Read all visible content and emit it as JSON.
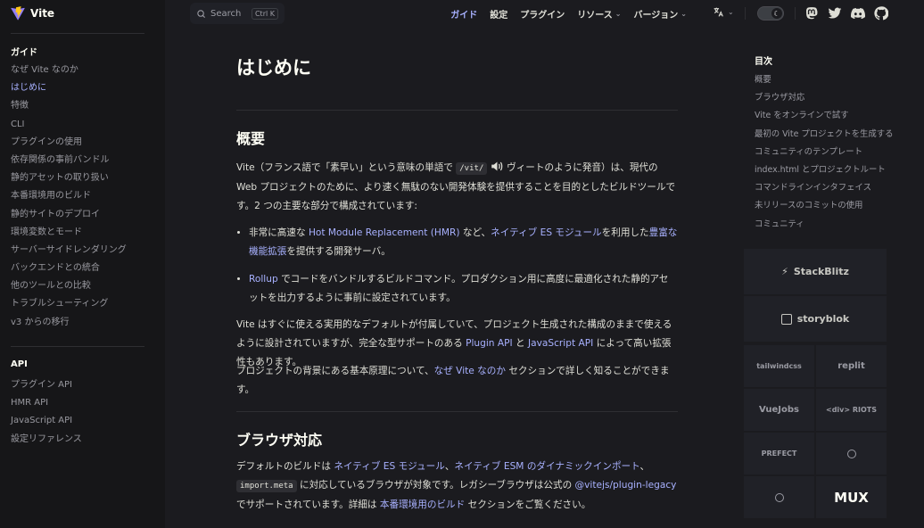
{
  "brand": {
    "title": "Vite",
    "logo_icon": "vite-logo-icon",
    "accent": "#a8b1ff"
  },
  "sidebar": {
    "guide": {
      "heading": "ガイド",
      "items": [
        {
          "label": "なぜ Vite なのか"
        },
        {
          "label": "はじめに",
          "active": true
        },
        {
          "label": "特徴"
        },
        {
          "label": "CLI"
        },
        {
          "label": "プラグインの使用"
        },
        {
          "label": "依存関係の事前バンドル"
        },
        {
          "label": "静的アセットの取り扱い"
        },
        {
          "label": "本番環境用のビルド"
        },
        {
          "label": "静的サイトのデプロイ"
        },
        {
          "label": "環境変数とモード"
        },
        {
          "label": "サーバーサイドレンダリング"
        },
        {
          "label": "バックエンドとの統合"
        },
        {
          "label": "他のツールとの比較"
        },
        {
          "label": "トラブルシューティング"
        },
        {
          "label": "v3 からの移行"
        }
      ]
    },
    "api": {
      "heading": "API",
      "items": [
        {
          "label": "プラグイン API"
        },
        {
          "label": "HMR API"
        },
        {
          "label": "JavaScript API"
        },
        {
          "label": "設定リファレンス"
        }
      ]
    }
  },
  "topbar": {
    "search": {
      "label": "Search",
      "shortcut": "Ctrl K",
      "icon": "search-icon"
    },
    "nav": [
      {
        "label": "ガイド",
        "active": true
      },
      {
        "label": "設定"
      },
      {
        "label": "プラグイン"
      },
      {
        "label": "リソース",
        "dropdown": true
      },
      {
        "label": "バージョン",
        "dropdown": true
      }
    ],
    "lang_icon": "translate-icon",
    "theme_icon": "moon-icon",
    "social": [
      "mastodon-icon",
      "twitter-icon",
      "discord-icon",
      "github-icon"
    ]
  },
  "main": {
    "title": "はじめに",
    "overview": {
      "heading": "概要",
      "p1": {
        "a": "Vite（フランス語で「素早い」という意味の単語で ",
        "code": "/vit/",
        "b": " ヴィートのように発音）は、現代の Web プロジェクトのために、より速く無駄のない開発体験を提供することを目的としたビルドツールです。2 つの主要な部分で構成されています:"
      },
      "bullet1": {
        "a": "非常に高速な ",
        "link1": "Hot Module Replacement (HMR)",
        "b": " など、",
        "link2": "ネイティブ ES モジュール",
        "c": "を利用した",
        "link3": "豊富な機能拡張",
        "d": "を提供する開発サーバ。"
      },
      "bullet2": {
        "link1": "Rollup",
        "a": " でコードをバンドルするビルドコマンド。プロダクション用に高度に最適化された静的アセットを出力するように事前に設定されています。"
      },
      "p2": {
        "a": "Vite はすぐに使える実用的なデフォルトが付属していて、プロジェクト生成された構成のままで使えるように設計されていますが、完全な型サポートのある ",
        "link1": "Plugin API",
        "b": " と ",
        "link2": "JavaScript API",
        "c": " によって高い拡張性もあります。"
      },
      "p3": {
        "a": "プロジェクトの背景にある基本原理について、",
        "link1": "なぜ Vite なのか",
        "b": " セクションで詳しく知ることができます。"
      }
    },
    "browser": {
      "heading": "ブラウザ対応",
      "p1": {
        "a": "デフォルトのビルドは ",
        "link1": "ネイティブ ES モジュール",
        "b": "、",
        "link2": "ネイティブ ESM のダイナミックインポート",
        "c": "、",
        "code": "import.meta",
        "d": " に対応しているブラウザが対象です。レガシーブラウザは公式の ",
        "link3": "@vitejs/plugin-legacy",
        "e": " でサポートされています。詳細は ",
        "link4": "本番環境用のビルド",
        "f": " セクションをご覧ください。"
      }
    }
  },
  "toc": {
    "title": "目次",
    "items": [
      {
        "label": "概要"
      },
      {
        "label": "ブラウザ対応"
      },
      {
        "label": "Vite をオンラインで試す"
      },
      {
        "label": "最初の Vite プロジェクトを生成する"
      },
      {
        "label": "コミュニティのテンプレート"
      },
      {
        "label": "index.html とプロジェクトルート"
      },
      {
        "label": "コマンドラインインタフェイス"
      },
      {
        "label": "未リリースのコミットの使用"
      },
      {
        "label": "コミュニティ"
      }
    ]
  },
  "sponsors": {
    "big": [
      {
        "label": "StackBlitz",
        "icon": "bolt-icon"
      },
      {
        "label": "storyblok",
        "icon": "storyblok-icon"
      }
    ],
    "small": [
      {
        "label": "tailwindcss"
      },
      {
        "label": "replit"
      },
      {
        "label": "VueJobs"
      },
      {
        "label": "<div> RIOTS"
      },
      {
        "label": "PREFECT"
      },
      {
        "label": "",
        "icon": "sponsor-logo-icon"
      },
      {
        "label": "",
        "icon": "sponsor-logo-icon-2"
      },
      {
        "label": "MUX"
      }
    ]
  }
}
